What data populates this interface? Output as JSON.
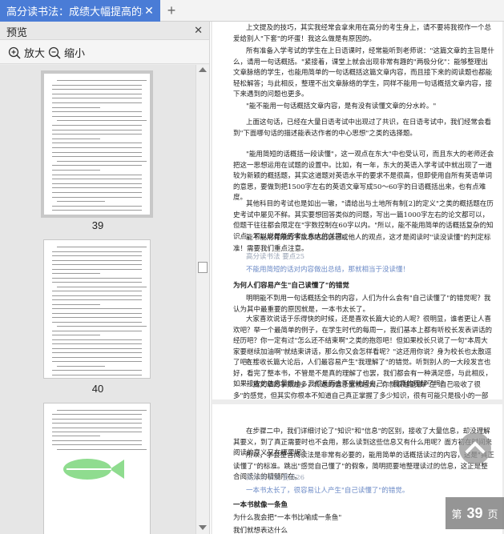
{
  "tab": {
    "title": "高分读书法：成绩大幅提高的秘",
    "close": "✕",
    "new": "+"
  },
  "sidebar": {
    "title": "预览",
    "close": "✕",
    "zoom_in": "放大",
    "zoom_out": "缩小",
    "thumbs": [
      {
        "label": "39"
      },
      {
        "label": "40"
      }
    ]
  },
  "page1": {
    "paragraphs": [
      "上文提及的技巧，其实我经常会拿来用在高分的考生身上，请不要将我视作一个总爱给别人\"下套\"的坏蛋！我这么做是有原因的。",
      "所有准备入学考试的学生在上日语课时，经常能听到老师说：\"这篇文章的主旨是什么，请用一句话概括。\"紧接着，课堂上就会出现非常有趣的\"两极分化\"：能够整理出文章脉络的学生，也能用简单的一句话概括这篇文章内容，而且接下来的阅读题也都能轻松解答；与此相反，整理不出文章脉络的学生，同样不能用一句话概括文章内容，接下来遇到的问题也更多。",
      "\"能不能用一句话概括文章内容，是有没有读懂文章的分水岭。\"",
      "上面这句话，已经在大量日语考试中出现过了共识，在日语考试中，我们经常会看到\"下面哪句话的描述能表达作者的中心思想\"之类的选择题。",
      "\"能用简短的话概括一段读懂\"，这一观点在东大\"中也受认可，而且东大的老师还会把这一思想运用在试题的设置中。比如，有一年，东大的英语入学考试中就出现了一道较为新颖的概括题，其实这道题对英语水平的要求不是很高，但即使用自所有英语单词的意思，要做到把1500字左右的英语文章写成50～60字的日语概括出来，也有点难度。",
      "其他科目的考试也是如出一辙，\"请给出与土地所有制[2]的定义\"之类的概括题在历史考试中屡见不鲜。其实要想回答类似的问题，写出一篇1000字左右的论文都可以，但题干往往都会限定在\"字数控制在60字以内。\"所以，能不能用简单的话概括复杂的知识点，可以说是能否考上东大的关键。",
      "能不能用有限的字数总结出自己或他人的观点，这才是阅读时\"读没读懂\"的判定标准！需要我们重点注意。",
      "高分读书法 要点25",
      "不能用简短的话对内容做出总结，那就相当于没读懂！",
      "为何人们容易产生\"自己读懂了\"的错觉",
      "明明能不到用一句话概括全书的内容，人们为什么会有\"自己读懂了\"的错觉呢？我认为其中最重要的原因就是，一本书太长了。",
      "大家喜欢说话于乐得快的时候，还是喜欢长篇大论的人呢？很明显，谁者更让人喜欢吧？举一个最简单的例子，在学生时代的每周一，我们基本上都有听校长发表讲话的经历吧？你一定有过\"怎么还不结束啊\"之类的抱怨吧！但如果校长只说了一句\"本周大家要继续加油啊\"就结束讲话，那么你又会怎样看呢？\"这还用你说？身为校长也太散逗了吧？\"",
      "在接收长篇大论后，人们最容易产生\"我理解了\"的错觉。听到别人的一大段发言也好，看完了整本书，不管是不是真的理解了也罢，我们都会有一种满足感，与此相反，如果接收的信息量很小，我们反而会不安地问自己：\"我真的理解了吗？\"",
      "一篇文章的字数越多，传递的信息量就越大，你就很越能够产生\"自己吸收了很多\"的感觉，但其实你根本不知道自己真正掌握了多少知识，很有可能只是极小的一部分而已。"
    ]
  },
  "page2": {
    "paragraphs": [
      "在步骤二中，我们详细讨论了\"知识\"和\"信息\"的区别，接收了大量信息，却没理解其要义，到了真正需要时也不会用，那么读到这些信息又有什么用呢？面方初在时间来阅读的意义又在哪里呢？",
      "所以，学会整合阅读法是非常有必要的，能用简单的话概括读过的内容，这是\"真正读懂了\"的标准。跳出\"感觉自己懂了\"的假象，简明扼要地整理读过的信息，这正是整合阅读法的精髓所在。",
      "高分读书法 要点26",
      "一本书太长了，很容易让人产生\"自己读懂了\"的错觉。",
      "一本书就像一条鱼",
      "为什么我会把\"一本书比喻成一条鱼\"",
      "我们就想表达什么"
    ]
  },
  "indicator": {
    "prefix": "第",
    "number": "39",
    "suffix": "页"
  }
}
